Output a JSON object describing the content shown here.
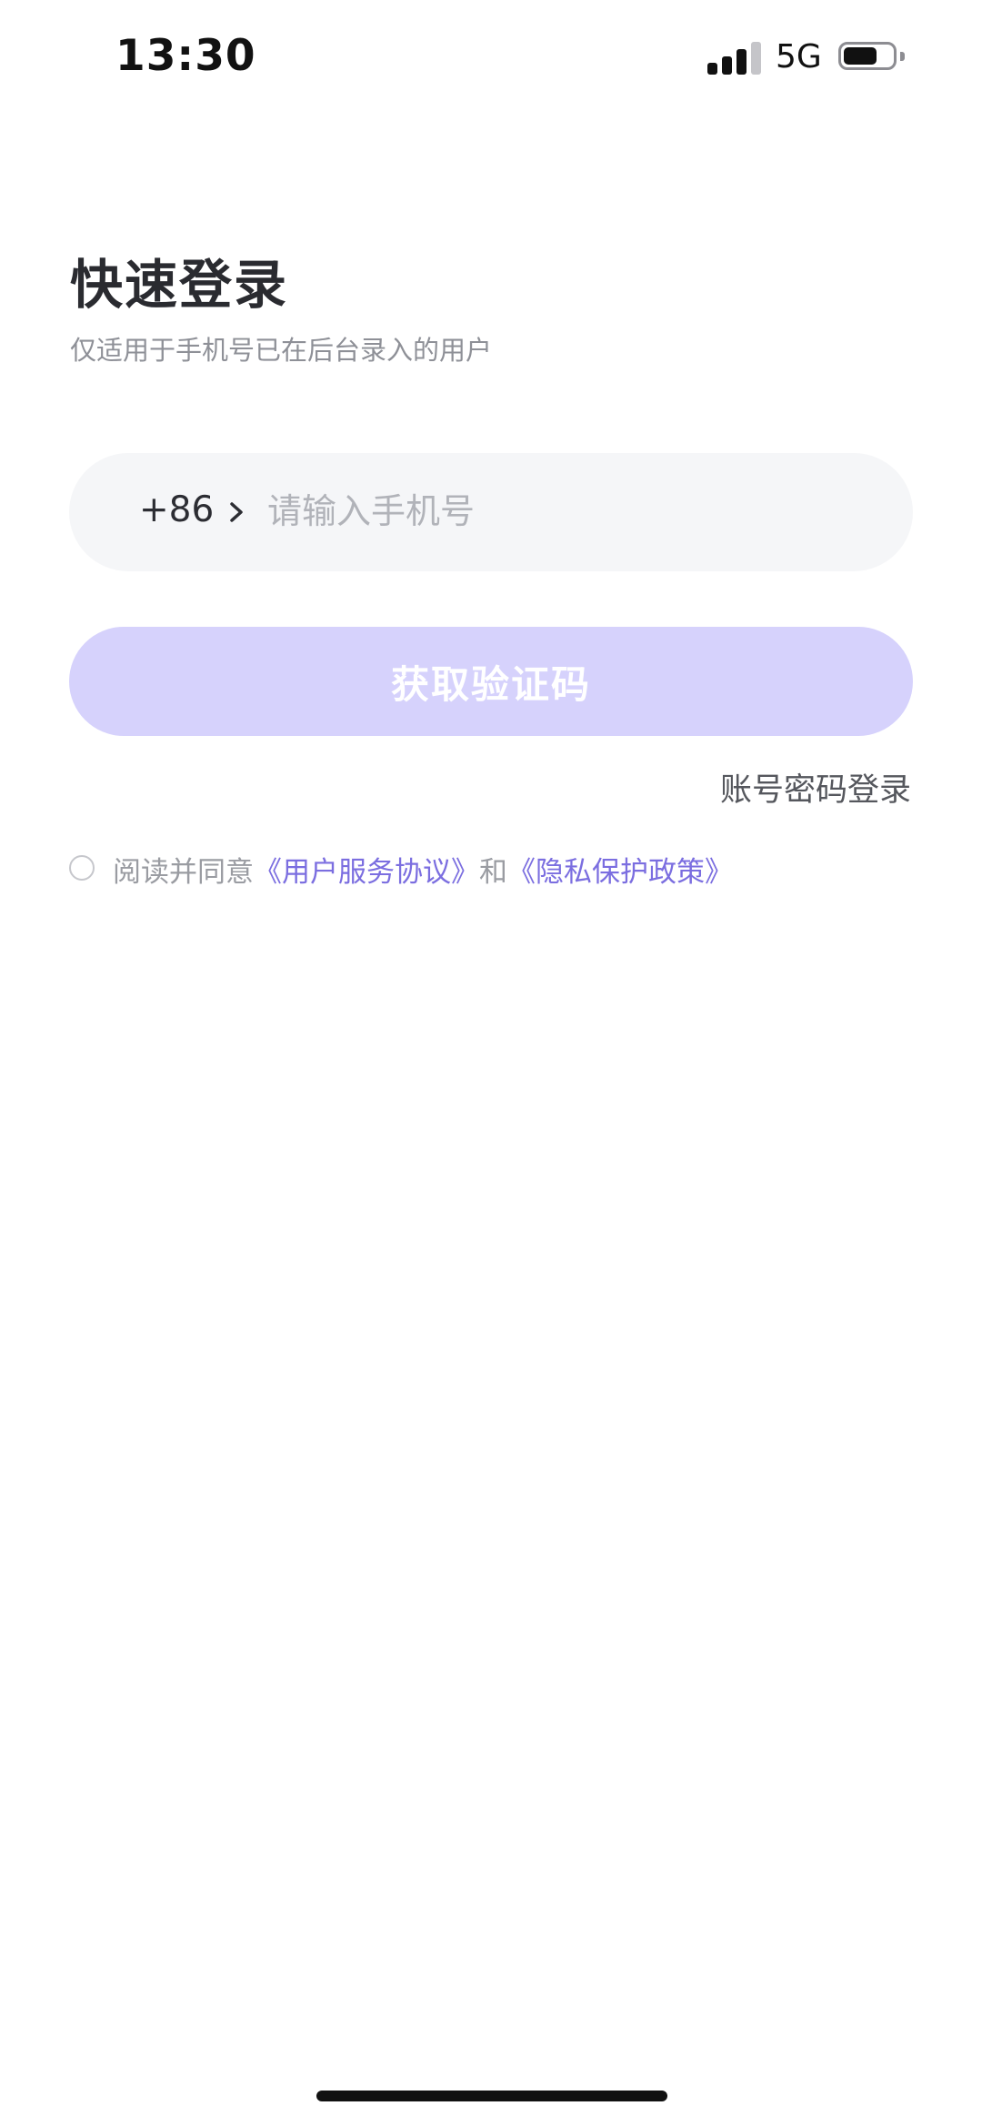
{
  "status_bar": {
    "time": "13:30",
    "network": "5G",
    "icons": [
      "signal-icon",
      "battery-icon"
    ]
  },
  "page": {
    "title": "快速登录",
    "subtitle": "仅适用于手机号已在后台录入的用户"
  },
  "phone_field": {
    "country_code": "+86",
    "placeholder": "请输入手机号",
    "value": "",
    "icon": "chevron-right-icon"
  },
  "primary_button": {
    "label": "获取验证码",
    "state": "disabled"
  },
  "account_login_label": "账号密码登录",
  "agreement": {
    "prefix": "阅读并同意",
    "user_agreement": "《用户服务协议》",
    "conjunction": "和",
    "privacy_policy": "《隐私保护政策》",
    "checked": false
  },
  "colors": {
    "accent": "#7b6ee0",
    "button_disabled": "#d6d2fc",
    "field_background": "#f5f6f8",
    "title_text": "#2a2b30",
    "muted_text": "#8e9097"
  }
}
